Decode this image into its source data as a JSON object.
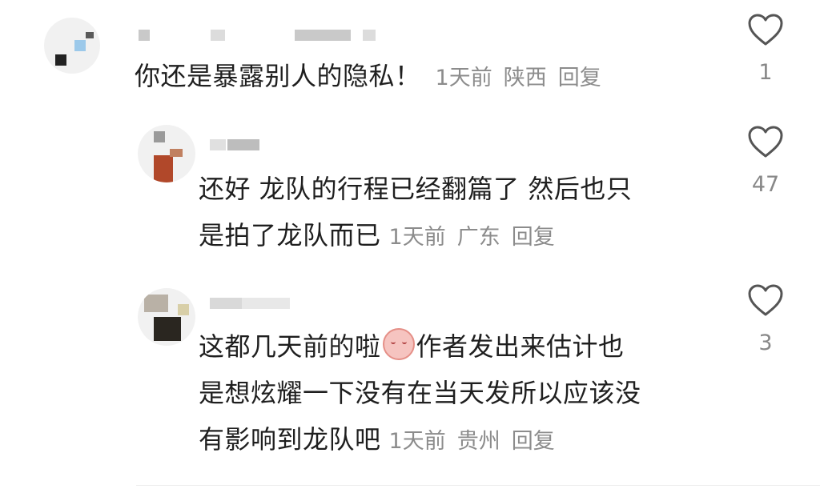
{
  "comments": [
    {
      "text_lines": [
        "你还是暴露别人的隐私！"
      ],
      "time": "1天前",
      "location": "陕西",
      "reply_label": "回复",
      "likes": "1"
    },
    {
      "text_lines": [
        "还好 龙队的行程已经翻篇了 然后也只",
        "是拍了龙队而已"
      ],
      "time": "1天前",
      "location": "广东",
      "reply_label": "回复",
      "likes": "47"
    },
    {
      "text_lines": [
        "这都几天前的啦",
        "作者发出来估计也",
        "是想炫耀一下没有在当天发所以应该没",
        "有影响到龙队吧"
      ],
      "emoji": "blushing-face-emoji",
      "time": "1天前",
      "location": "贵州",
      "reply_label": "回复",
      "likes": "3"
    }
  ],
  "icons": {
    "like": "heart-outline-icon"
  },
  "colors": {
    "text": "#1f1f1f",
    "meta": "#8c8c8c",
    "icon": "#555555"
  }
}
